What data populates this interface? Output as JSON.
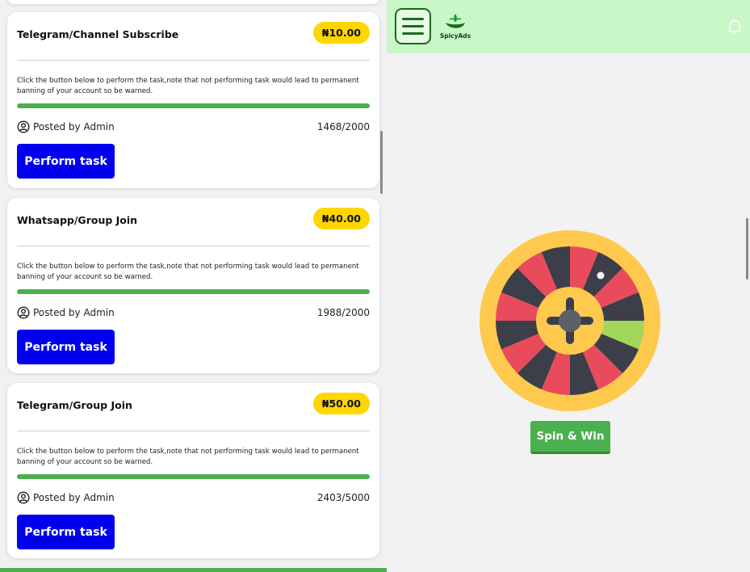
{
  "tasks": [
    {
      "title": "Telegram/Channel Subscribe",
      "price": "₦10.00",
      "description": "Click the button below to perform the task,note that not performing task would lead to permanent banning of your account so be warned.",
      "poster": "Posted by Admin",
      "count": "1468/2000",
      "progress_fraction": 1.0,
      "button_label": "Perform task"
    },
    {
      "title": "Whatsapp/Group Join",
      "price": "₦40.00",
      "description": "Click the button below to perform the task,note that not performing task would lead to permanent banning of your account so be warned.",
      "poster": "Posted by Admin",
      "count": "1988/2000",
      "progress_fraction": 1.0,
      "button_label": "Perform task"
    },
    {
      "title": "Telegram/Group Join",
      "price": "₦50.00",
      "description": "Click the button below to perform the task,note that not performing task would lead to permanent banning of your account so be warned.",
      "poster": "Posted by Admin",
      "count": "2403/5000",
      "progress_fraction": 1.0,
      "button_label": "Perform task"
    }
  ],
  "header": {
    "logo_text": "SpicyAds",
    "menu_icon": "hamburger-menu-icon",
    "notification_icon": "bell-icon"
  },
  "spin": {
    "button_label": "Spin & Win"
  },
  "colors": {
    "accent_green": "#4caf50",
    "header_bg": "#c8f7c8",
    "task_button": "#0000ee",
    "price_badge": "#ffd600",
    "wheel_rim": "#ffc94d",
    "wheel_red": "#e84c5c",
    "wheel_dark": "#3c3f4a",
    "wheel_highlight": "#a3d65c"
  }
}
